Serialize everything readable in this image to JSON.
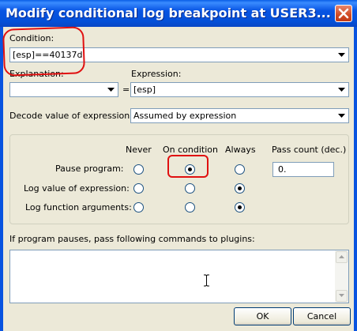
{
  "window": {
    "title": "Modify conditional log breakpoint at USER3...",
    "close_label": "close"
  },
  "condition": {
    "label": "Condition:",
    "value": "[esp]==40137d"
  },
  "explanation": {
    "label": "Explanation:",
    "value": ""
  },
  "equals_sign": "=",
  "expression": {
    "label": "Expression:",
    "value": "[esp]"
  },
  "decode": {
    "label": "Decode value of expression as:",
    "value": "Assumed by expression"
  },
  "grid": {
    "columns": [
      "Never",
      "On condition",
      "Always",
      "Pass count (dec.)"
    ],
    "rows": [
      {
        "label": "Pause program:",
        "selected": "On condition"
      },
      {
        "label": "Log value of expression:",
        "selected": "Always"
      },
      {
        "label": "Log function arguments:",
        "selected": "Always"
      }
    ],
    "pass_count": "0."
  },
  "plugins": {
    "label": "If program pauses, pass following commands to plugins:",
    "value": ""
  },
  "buttons": {
    "ok": "OK",
    "cancel": "Cancel"
  },
  "icons": {
    "close": "close-x-icon",
    "dropdown": "chevron-down-icon",
    "scroll_up": "triangle-up-icon",
    "scroll_down": "triangle-down-icon",
    "cursor": "text-ibeam-icon"
  },
  "colors": {
    "titlebar": "#0854e3",
    "dialog_bg": "#ece9d8",
    "annotation": "#e01010",
    "close_button": "#d04a23"
  }
}
